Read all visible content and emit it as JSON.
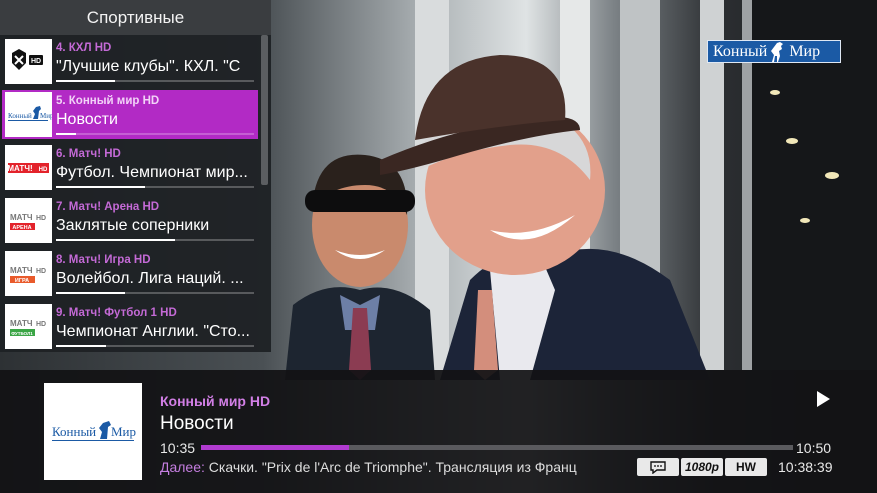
{
  "watermark": {
    "text_left": "Конный",
    "text_right": "Мир"
  },
  "channel_list": {
    "header": "Спортивные",
    "items": [
      {
        "meta": "4. КХЛ HD",
        "title": "\"Лучшие клубы\". КХЛ. \"С",
        "progress": 0.3,
        "logo": "khl-hd-logo",
        "active": false
      },
      {
        "meta": "5. Конный мир HD",
        "title": "Новости",
        "progress": 0.1,
        "logo": "konny-mir-logo",
        "active": true
      },
      {
        "meta": "6. Матч! HD",
        "title": "Футбол. Чемпионат мир...",
        "progress": 0.45,
        "logo": "match-hd-logo",
        "active": false
      },
      {
        "meta": "7. Матч! Арена HD",
        "title": "Заклятые соперники",
        "progress": 0.6,
        "logo": "match-arena-logo",
        "active": false
      },
      {
        "meta": "8. Матч! Игра HD",
        "title": "Волейбол. Лига наций. ...",
        "progress": 0.35,
        "logo": "match-igra-logo",
        "active": false
      },
      {
        "meta": "9. Матч! Футбол 1 HD",
        "title": "Чемпионат Англии. \"Сто...",
        "progress": 0.25,
        "logo": "match-football1-logo",
        "active": false
      }
    ]
  },
  "info_bar": {
    "channel": "Конный мир HD",
    "title": "Новости",
    "time_start": "10:35",
    "time_end": "10:50",
    "progress": 0.25,
    "next_label": "Далее:",
    "next_text": " Скачки. \"Prix de l'Arc de Triomphe\". Трансляция из Франц",
    "badges": {
      "subtitles": "",
      "resolution": "1080p",
      "decoder": "HW"
    },
    "clock": "10:38:39",
    "logo_text_left": "Конный",
    "logo_text_right": "Мир"
  },
  "colors": {
    "accent": "#b22ac5",
    "watermark_bg": "#1b5aa5"
  }
}
